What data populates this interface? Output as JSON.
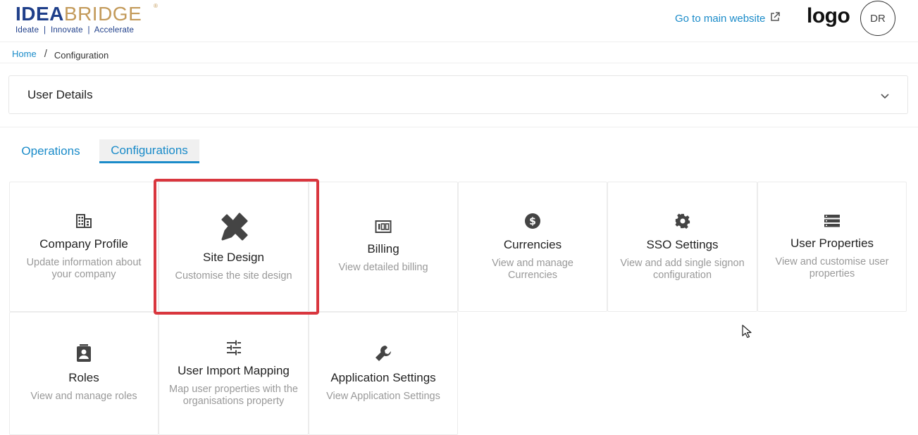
{
  "header": {
    "brand": {
      "part1": "IDEA",
      "part2": "BRIDGE",
      "registered": "®",
      "tagline": "Ideate  |  Innovate  |  Accelerate"
    },
    "main_website_link": "Go to main website",
    "logo_text": "logo",
    "avatar_initials": "DR"
  },
  "breadcrumb": {
    "home": "Home",
    "separator": "/",
    "current": "Configuration"
  },
  "accordion": {
    "title": "User Details"
  },
  "tabs": [
    {
      "label": "Operations",
      "active": false
    },
    {
      "label": "Configurations",
      "active": true
    }
  ],
  "cards": [
    {
      "title": "Company Profile",
      "description": "Update information about your company",
      "icon": "building-icon"
    },
    {
      "title": "Site Design",
      "description": "Customise the site design",
      "icon": "design-tools-icon",
      "highlighted": true
    },
    {
      "title": "Billing",
      "description": "View detailed billing",
      "icon": "billing-icon"
    },
    {
      "title": "Currencies",
      "description": "View and manage Currencies",
      "icon": "currency-icon"
    },
    {
      "title": "SSO Settings",
      "description": "View and add single signon configuration",
      "icon": "gear-icon"
    },
    {
      "title": "User Properties",
      "description": "View and customise user properties",
      "icon": "list-icon"
    },
    {
      "title": "Roles",
      "description": "View and manage roles",
      "icon": "badge-icon"
    },
    {
      "title": "User Import Mapping",
      "description": "Map user properties with the organisations property",
      "icon": "sliders-icon"
    },
    {
      "title": "Application Settings",
      "description": "View Application Settings",
      "icon": "wrench-icon"
    }
  ],
  "colors": {
    "accent": "#1a8bc9",
    "brand_blue": "#1f3f8a",
    "brand_gold": "#c39a5a",
    "highlight_red": "#d9363e"
  }
}
